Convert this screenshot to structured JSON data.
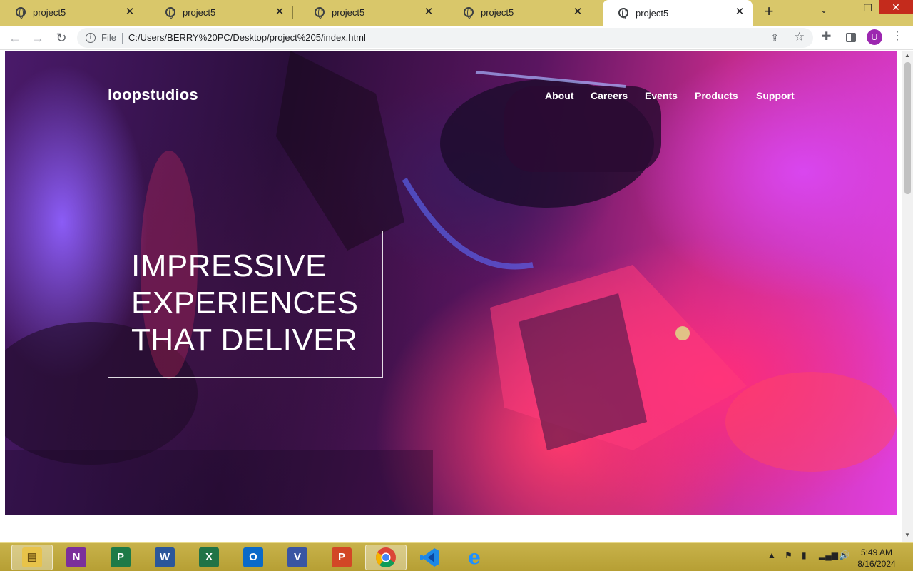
{
  "browser": {
    "tabs": [
      {
        "title": "project5",
        "active": false
      },
      {
        "title": "project5",
        "active": false
      },
      {
        "title": "project5",
        "active": false
      },
      {
        "title": "project5",
        "active": false
      },
      {
        "title": "project5",
        "active": true
      }
    ],
    "new_tab": "+",
    "tab_search": "⌄",
    "window": {
      "minimize": "–",
      "restore": "❐",
      "close": "✕"
    },
    "toolbar": {
      "back": "←",
      "forward": "→",
      "reload": "↻",
      "file_label": "File",
      "url": "C:/Users/BERRY%20PC/Desktop/project%205/index.html",
      "profile_initial": "U"
    }
  },
  "page": {
    "logo": "loopstudios",
    "nav": [
      "About",
      "Careers",
      "Events",
      "Products",
      "Support"
    ],
    "headline": [
      "IMPRESSIVE",
      "EXPERIENCES",
      "THAT DELIVER"
    ]
  },
  "taskbar": {
    "apps": [
      {
        "name": "file-explorer",
        "glyph": "▤",
        "color": "#e8c34a",
        "active": true
      },
      {
        "name": "onenote",
        "glyph": "N",
        "color": "#7b2f9b",
        "active": false
      },
      {
        "name": "publisher",
        "glyph": "P",
        "color": "#1d7a47",
        "active": false
      },
      {
        "name": "word",
        "glyph": "W",
        "color": "#2b579a",
        "active": false
      },
      {
        "name": "excel",
        "glyph": "X",
        "color": "#217346",
        "active": false
      },
      {
        "name": "outlook",
        "glyph": "O",
        "color": "#0a6ac9",
        "active": false
      },
      {
        "name": "visio",
        "glyph": "V",
        "color": "#3955a3",
        "active": false
      },
      {
        "name": "powerpoint",
        "glyph": "P",
        "color": "#d24726",
        "active": false
      },
      {
        "name": "chrome",
        "glyph": "",
        "color": "#ffffff",
        "active": true
      },
      {
        "name": "vscode",
        "glyph": "",
        "color": "#1e88e5",
        "active": false
      },
      {
        "name": "internet-explorer",
        "glyph": "e",
        "color": "#1e90ff",
        "active": false
      }
    ],
    "clock": {
      "time": "5:49 AM",
      "date": "8/16/2024"
    }
  }
}
